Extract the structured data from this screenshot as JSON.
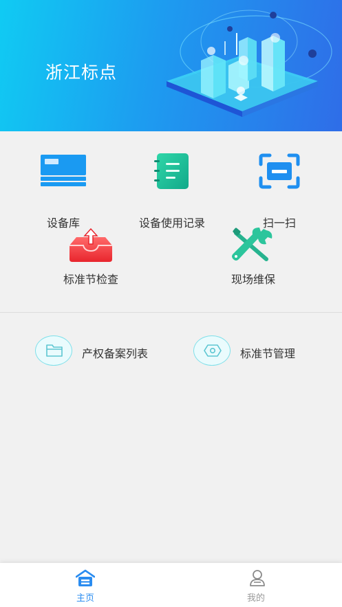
{
  "banner": {
    "title": "浙江标点"
  },
  "menu": [
    {
      "label": "设备库",
      "icon": "card-icon"
    },
    {
      "label": "设备使用记录",
      "icon": "notebook-icon"
    },
    {
      "label": "扫一扫",
      "icon": "scan-icon"
    },
    {
      "label": "标准节检查",
      "icon": "inbox-upload-icon"
    },
    {
      "label": "现场维保",
      "icon": "wrench-screwdriver-icon"
    }
  ],
  "quick_links": [
    {
      "label": "产权备案列表",
      "icon": "folder-icon"
    },
    {
      "label": "标准节管理",
      "icon": "hexagon-nut-icon"
    }
  ],
  "tabbar": {
    "home": {
      "label": "主页",
      "icon": "home-icon",
      "active": true
    },
    "mine": {
      "label": "我的",
      "icon": "user-icon",
      "active": false
    }
  },
  "colors": {
    "active_tab": "#2a8cf0",
    "inactive_tab": "#999999",
    "banner_start": "#10cbf3",
    "banner_end": "#2f6de8"
  }
}
